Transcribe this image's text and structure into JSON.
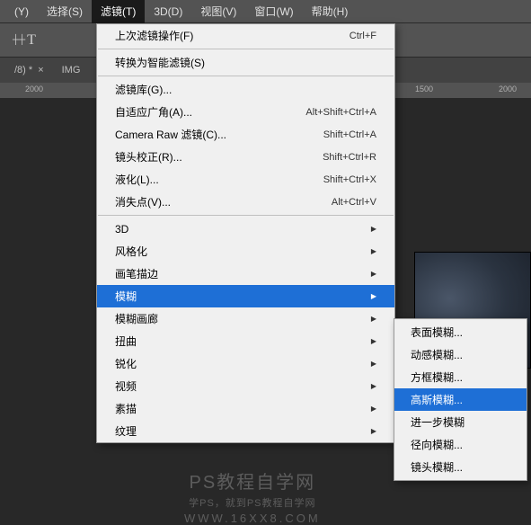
{
  "menubar": [
    {
      "label": "(Y)"
    },
    {
      "label": "选择(S)"
    },
    {
      "label": "滤镜(T)",
      "active": true
    },
    {
      "label": "3D(D)"
    },
    {
      "label": "视图(V)"
    },
    {
      "label": "窗口(W)"
    },
    {
      "label": "帮助(H)"
    }
  ],
  "tabs": [
    {
      "label": "/8) *"
    },
    {
      "label": "IMG"
    }
  ],
  "ruler_marks": [
    {
      "pos": 28,
      "label": "2000"
    },
    {
      "pos": 462,
      "label": "1500"
    },
    {
      "pos": 555,
      "label": "2000"
    }
  ],
  "dropdown": {
    "section1": [
      {
        "label": "上次滤镜操作(F)",
        "shortcut": "Ctrl+F"
      }
    ],
    "section2": [
      {
        "label": "转换为智能滤镜(S)"
      }
    ],
    "section3": [
      {
        "label": "滤镜库(G)...",
        "shortcut": ""
      },
      {
        "label": "自适应广角(A)...",
        "shortcut": "Alt+Shift+Ctrl+A"
      },
      {
        "label": "Camera Raw 滤镜(C)...",
        "shortcut": "Shift+Ctrl+A"
      },
      {
        "label": "镜头校正(R)...",
        "shortcut": "Shift+Ctrl+R"
      },
      {
        "label": "液化(L)...",
        "shortcut": "Shift+Ctrl+X"
      },
      {
        "label": "消失点(V)...",
        "shortcut": "Alt+Ctrl+V"
      }
    ],
    "section4": [
      {
        "label": "3D",
        "arrow": true
      },
      {
        "label": "风格化",
        "arrow": true
      },
      {
        "label": "画笔描边",
        "arrow": true
      },
      {
        "label": "模糊",
        "arrow": true,
        "highlight": true
      },
      {
        "label": "模糊画廊",
        "arrow": true
      },
      {
        "label": "扭曲",
        "arrow": true
      },
      {
        "label": "锐化",
        "arrow": true
      },
      {
        "label": "视频",
        "arrow": true
      },
      {
        "label": "素描",
        "arrow": true
      },
      {
        "label": "纹理",
        "arrow": true
      }
    ]
  },
  "submenu": [
    {
      "label": "表面模糊..."
    },
    {
      "label": "动感模糊..."
    },
    {
      "label": "方框模糊..."
    },
    {
      "label": "高斯模糊...",
      "highlight": true
    },
    {
      "label": "进一步模糊"
    },
    {
      "label": "径向模糊..."
    },
    {
      "label": "镜头模糊..."
    }
  ],
  "watermark": {
    "title": "PS教程自学网",
    "sub": "学PS，就到PS教程自学网",
    "url": "WWW.16XX8.COM"
  }
}
